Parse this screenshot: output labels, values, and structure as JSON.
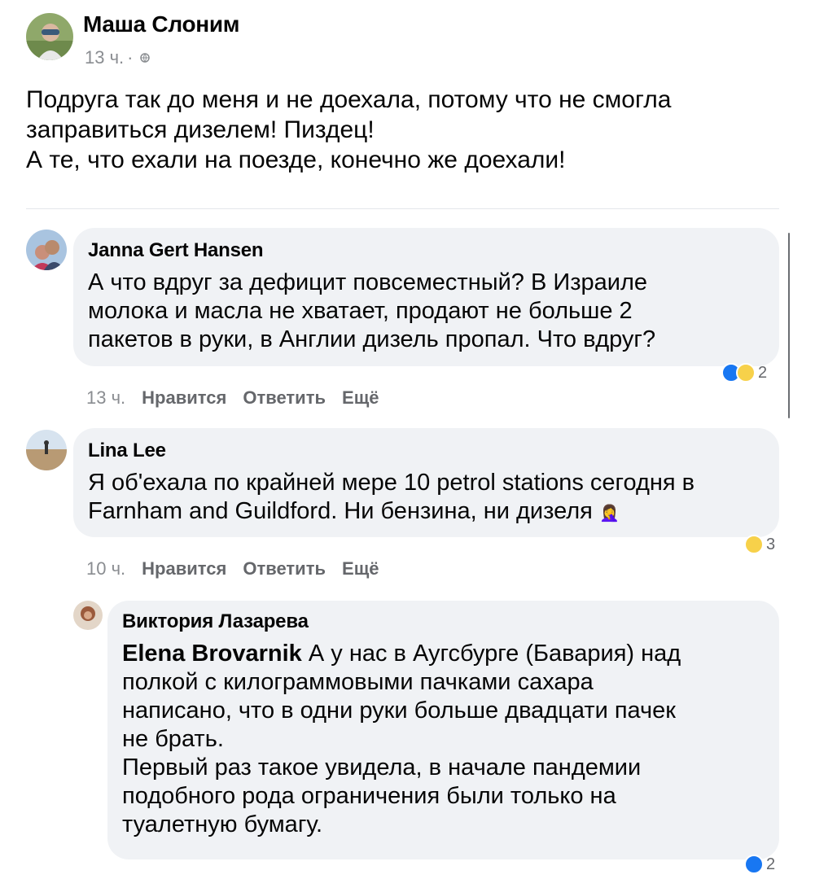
{
  "post": {
    "author": "Маша Слоним",
    "time": "13 ч.",
    "separator": "·",
    "lines": [
      "Подруга так до меня и не доехала, потому что не смогла",
      "заправиться дизелем! Пиздец!",
      "А те, что ехали на поезде, конечно же доехали!"
    ]
  },
  "comments": [
    {
      "author": "Janna Gert Hansen",
      "lines": [
        "А что вдруг за дефицит повсеместный? В Израиле",
        "молока и масла не хватает, продают не больше 2",
        "пакетов в руки, в Англии дизель пропал. Что вдруг?"
      ],
      "time": "13 ч.",
      "like": "Нравится",
      "reply": "Ответить",
      "more": "Ещё",
      "reactions": [
        "like-icon",
        "wow-icon"
      ],
      "reaction_count": "2"
    },
    {
      "author": "Lina Lee",
      "lines": [
        "Я об'ехала по крайней мере 10 petrol stations сегодня в",
        "Farnham and Guildford. Ни бензина, ни дизеля"
      ],
      "emoji": "🤦‍♀️",
      "time": "10 ч.",
      "like": "Нравится",
      "reply": "Ответить",
      "more": "Ещё",
      "reactions": [
        "wow-icon"
      ],
      "reaction_count": "3"
    },
    {
      "author": "Виктория Лазарева",
      "mention": "Elena Brovarnik",
      "first_line_rest": " А у нас в Аугсбурге (Бавария) над",
      "lines": [
        "полкой с килограммовыми пачками сахара",
        "написано, что в одни руки больше двадцати пачек",
        "не брать.",
        "Первый раз такое увидела, в начале пандемии",
        "подобного рода ограничения были только на",
        "туалетную бумагу."
      ],
      "reactions": [
        "like-icon"
      ],
      "reaction_count": "2"
    }
  ],
  "colors": {
    "bubble": "#f0f2f5",
    "secondary_text": "#65676b",
    "like_blue": "#1877f2",
    "wow_yellow": "#f7d14a"
  }
}
